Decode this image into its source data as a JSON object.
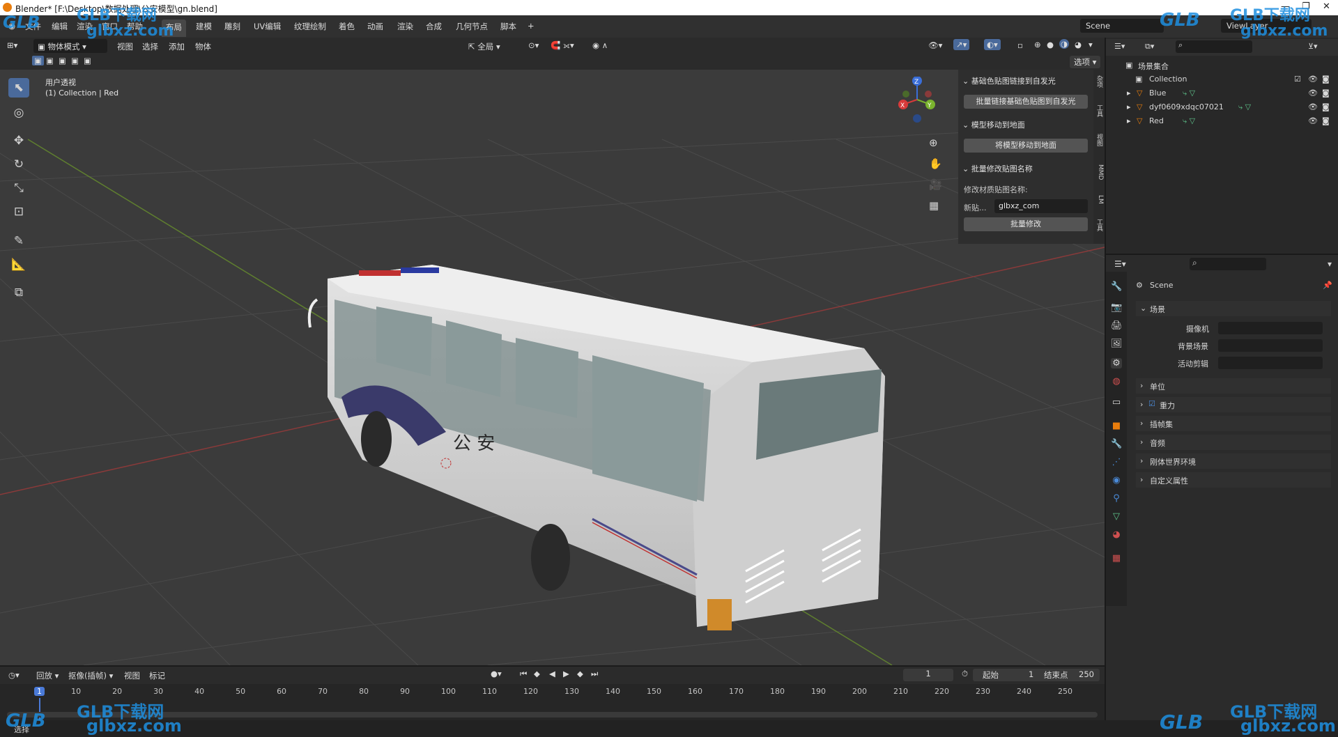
{
  "titlebar": {
    "title": "Blender* [F:\\Desktop\\数据处理\\公安模型\\gn.blend]"
  },
  "menubar": {
    "menus": [
      "文件",
      "编辑",
      "渲染",
      "窗口",
      "帮助"
    ],
    "workspaces": [
      "布局",
      "建模",
      "雕刻",
      "UV编辑",
      "纹理绘制",
      "着色",
      "动画",
      "渲染",
      "合成",
      "几何节点",
      "脚本"
    ],
    "add_tab": "+",
    "scene": "Scene",
    "view_layer": "ViewLayer"
  },
  "viewport_header": {
    "mode": "物体模式",
    "menus": [
      "视图",
      "选择",
      "添加",
      "物体"
    ],
    "orientation": "全局",
    "options": "选项"
  },
  "viewport": {
    "view_name": "用户透视",
    "collection_info": "(1) Collection | Red",
    "gizmo_axes": {
      "x": "X",
      "y": "Y",
      "z": "Z"
    },
    "side_text": "公 安"
  },
  "npanel": {
    "section1": {
      "title": "基础色贴图链接到自发光",
      "button": "批量链接基础色贴图到自发光"
    },
    "section2": {
      "title": "模型移动到地面",
      "button": "将模型移动到地面"
    },
    "section3": {
      "title": "批量修改贴图名称",
      "label": "修改材质贴图名称:",
      "field_label": "新贴...",
      "field_value": "glbxz_com",
      "button": "批量修改"
    },
    "tabs": [
      "杂项",
      "工具",
      "视图",
      "MMD",
      "LM",
      "工具"
    ]
  },
  "outliner": {
    "root": "场景集合",
    "collection": "Collection",
    "objects": [
      "Blue",
      "dyf0609xdqc07021",
      "Red"
    ]
  },
  "properties": {
    "title": "Scene",
    "panel": "场景",
    "camera_label": "摄像机",
    "background_label": "背景场景",
    "clip_label": "活动剪辑",
    "sections": [
      "单位",
      "重力",
      "插帧集",
      "音频",
      "刚体世界环境",
      "自定义属性"
    ]
  },
  "timeline": {
    "menus": [
      "回放",
      "抠像(插帧)",
      "视图",
      "标记"
    ],
    "current_frame": "1",
    "start_label": "起始",
    "start_value": "1",
    "end_label": "结束点",
    "end_value": "250",
    "ticks": [
      "1",
      "10",
      "20",
      "30",
      "40",
      "50",
      "60",
      "70",
      "80",
      "90",
      "100",
      "110",
      "120",
      "130",
      "140",
      "150",
      "160",
      "170",
      "180",
      "190",
      "200",
      "210",
      "220",
      "230",
      "240",
      "250"
    ]
  },
  "statusbar": {
    "left": "选择"
  },
  "watermarks": {
    "brand": "GLB下载网",
    "url": "glbxz.com",
    "logo": "GLB"
  },
  "colors": {
    "accent": "#4a6a9b",
    "orange": "#e87d0d"
  }
}
